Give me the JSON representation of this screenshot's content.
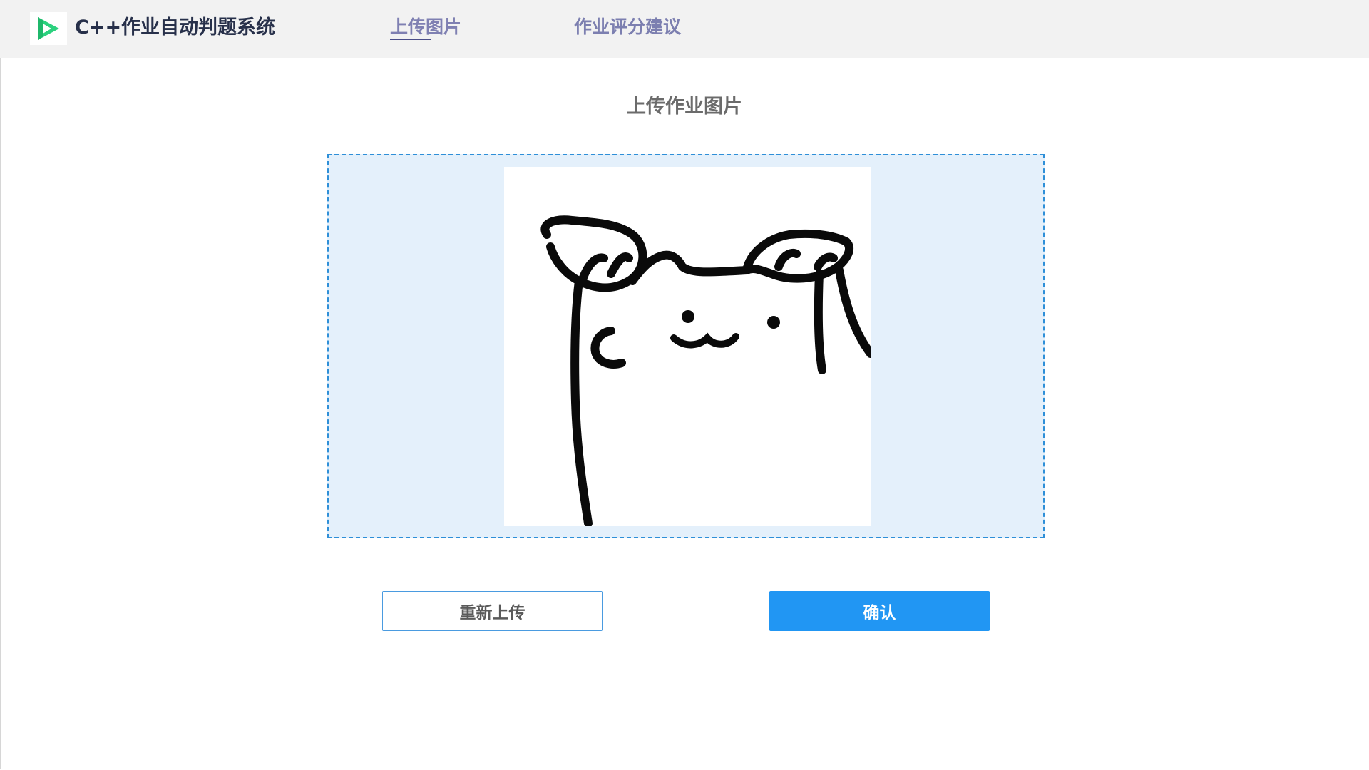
{
  "header": {
    "app_title": "C++作业自动判题系统",
    "logo_icon": "play-logo-icon",
    "tabs": [
      {
        "label": "上传图片",
        "active": true
      },
      {
        "label": "作业评分建议",
        "active": false
      }
    ]
  },
  "main": {
    "section_title": "上传作业图片",
    "dropzone": {
      "preview_image": "uploaded-doodle-image"
    },
    "buttons": {
      "reupload_label": "重新上传",
      "confirm_label": "确认"
    }
  },
  "colors": {
    "accent_blue": "#2196f3",
    "dropzone_bg": "#e4f0fb",
    "dropzone_border": "#2e8fd8",
    "logo_green": "#2bd17e",
    "tab_text": "#7c7fb0"
  }
}
